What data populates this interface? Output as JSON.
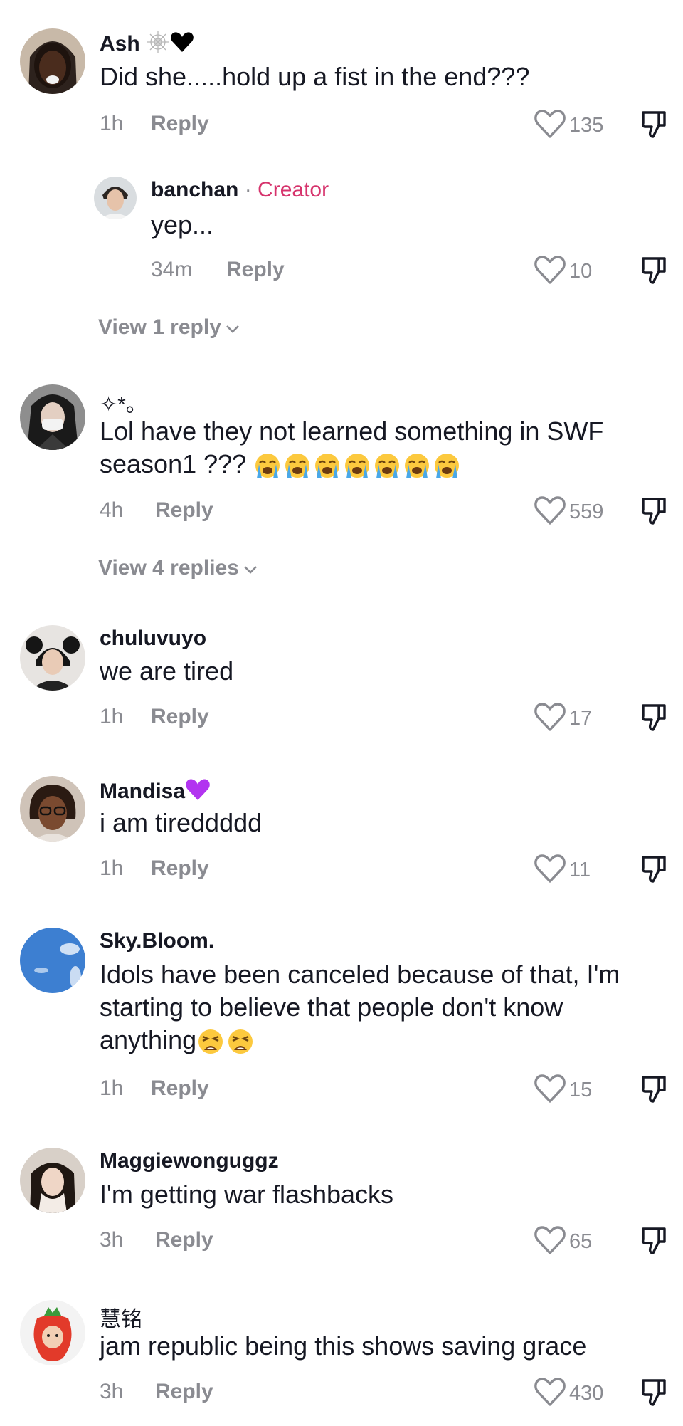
{
  "comments": [
    {
      "username": "Ash",
      "text": "Did she.....hold up a fist in the end???",
      "time": "1h",
      "reply": "Reply",
      "likes": "135"
    },
    {
      "username": "banchan",
      "creator_sep": "·",
      "creator_label": "Creator",
      "text": "yep...",
      "time": "34m",
      "reply": "Reply",
      "likes": "10"
    },
    {
      "username": "✧*。",
      "text": "Lol have they not learned something in SWF season1 ???",
      "time": "4h",
      "reply": "Reply",
      "likes": "559"
    },
    {
      "username": "chuluvuyo",
      "text": "we are tired",
      "time": "1h",
      "reply": "Reply",
      "likes": "17"
    },
    {
      "username": "Mandisa",
      "text": "i am tireddddd",
      "time": "1h",
      "reply": "Reply",
      "likes": "11"
    },
    {
      "username": "Sky.Bloom.",
      "text_lines": [
        "Idols have been canceled because of that, I'm",
        "starting to believe that people don't know",
        "anything"
      ],
      "time": "1h",
      "reply": "Reply",
      "likes": "15"
    },
    {
      "username": "Maggiewonguggz",
      "text": "I'm getting war flashbacks",
      "time": "3h",
      "reply": "Reply",
      "likes": "65"
    },
    {
      "username": "慧铭",
      "text": "jam republic being this shows saving grace",
      "time": "3h",
      "reply": "Reply",
      "likes": "430"
    }
  ],
  "view_replies": [
    "View 1 reply",
    "View 4 replies"
  ],
  "icons": {
    "like": "heart-outline-icon",
    "dislike": "thumbs-down-icon",
    "chevron": "chevron-down-icon"
  },
  "colors": {
    "creator": "#d6336c",
    "muted": "#8a8b91",
    "text": "#161823"
  }
}
